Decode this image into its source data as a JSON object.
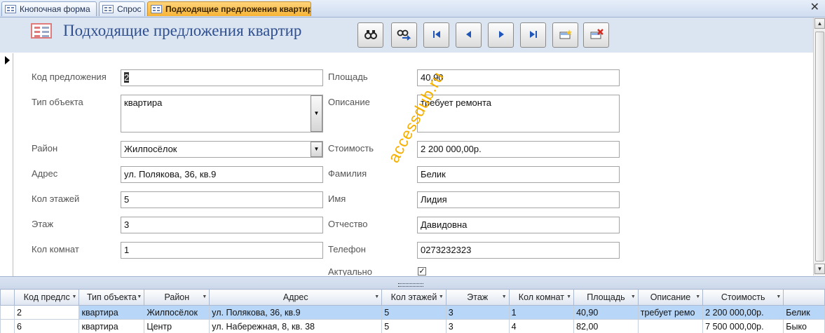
{
  "tabs": [
    {
      "label": "Кнопочная форма",
      "active": false
    },
    {
      "label": "Спрос",
      "active": false
    },
    {
      "label": "Подходящие предложения квартир",
      "active": true
    }
  ],
  "header": {
    "title": "Подходящие предложения квартир",
    "buttons": [
      "find-icon",
      "find-replace-icon",
      "first-record-icon",
      "previous-record-icon",
      "next-record-icon",
      "last-record-icon",
      "new-record-icon",
      "delete-record-icon"
    ]
  },
  "form": {
    "left": [
      {
        "label": "Код предложения",
        "value": "2"
      },
      {
        "label": "Тип объекта",
        "value": "квартира"
      },
      {
        "label": "Район",
        "value": "Жилпосёлок"
      },
      {
        "label": "Адрес",
        "value": "ул. Полякова, 36, кв.9"
      },
      {
        "label": "Кол этажей",
        "value": "5"
      },
      {
        "label": "Этаж",
        "value": "3"
      },
      {
        "label": "Кол комнат",
        "value": "1"
      }
    ],
    "right": [
      {
        "label": "Площадь",
        "value": "40,90"
      },
      {
        "label": "Описание",
        "value": "требует ремонта"
      },
      {
        "label": "Стоимость",
        "value": "2 200 000,00р."
      },
      {
        "label": "Фамилия",
        "value": "Белик"
      },
      {
        "label": "Имя",
        "value": "Лидия"
      },
      {
        "label": "Отчество",
        "value": "Давидовна"
      },
      {
        "label": "Телефон",
        "value": "0273232323"
      },
      {
        "label": "Актуально",
        "checked": true
      }
    ]
  },
  "watermark": "accessdub.ru",
  "datasheet": {
    "columns": [
      "Код предлс",
      "Тип объекта",
      "Район",
      "Адрес",
      "Кол этажей",
      "Этаж",
      "Кол комнат",
      "Площадь",
      "Описание",
      "Стоимость",
      ""
    ],
    "rows": [
      [
        "2",
        "квартира",
        "Жилпосёлок",
        "ул. Полякова, 36, кв.9",
        "5",
        "3",
        "1",
        "40,90",
        "требует ремо",
        "2 200 000,00р.",
        "Белик"
      ],
      [
        "6",
        "квартира",
        "Центр",
        "ул. Набережная, 8, кв. 38",
        "5",
        "3",
        "4",
        "82,00",
        "",
        "7 500 000,00р.",
        "Быко"
      ]
    ]
  }
}
